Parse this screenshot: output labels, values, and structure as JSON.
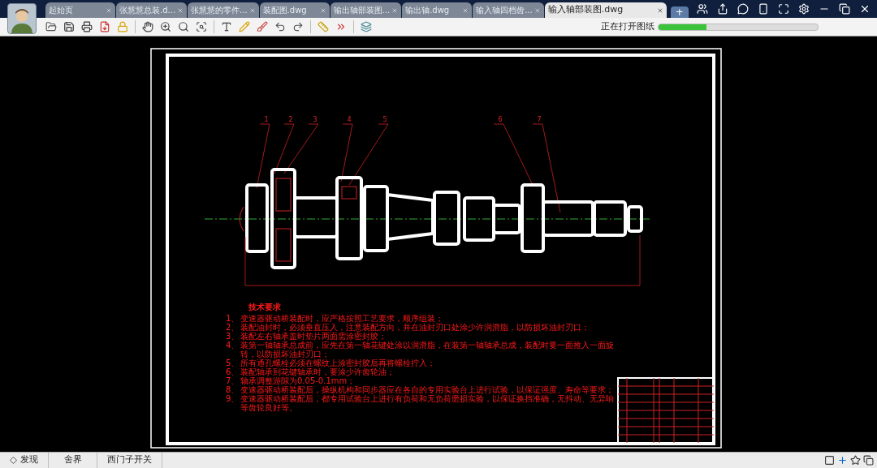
{
  "tabs": [
    {
      "label": "起始页",
      "selected": false
    },
    {
      "label": "张慧慧总装.d...",
      "selected": false
    },
    {
      "label": "张慧慧的零件...",
      "selected": false
    },
    {
      "label": "装配图.dwg",
      "selected": false
    },
    {
      "label": "输出轴部装图...",
      "selected": false
    },
    {
      "label": "输出轴.dwg",
      "selected": false
    },
    {
      "label": "输入轴四档齿...",
      "selected": false
    },
    {
      "label": "输入轴部装图.dwg",
      "selected": true
    }
  ],
  "new_tab": "+",
  "loading": {
    "label": "正在打开图纸",
    "level": 0.3
  },
  "drawing": {
    "balloons": [
      "1",
      "2",
      "3",
      "4",
      "5",
      "6",
      "7"
    ],
    "notes_title": "技术要求",
    "notes": [
      {
        "number": "1、",
        "text": "变速器驱动桥装配时，应严格按照工艺要求，顺序组装；"
      },
      {
        "number": "2、",
        "text": "装配油封时，必须垂直压入，注意装配方向，并在油封刃口处涂少许润滑脂，以防损坏油封刃口；"
      },
      {
        "number": "3、",
        "text": "装配左右轴承盖时垫片两面需涂密封胶；"
      },
      {
        "number": "4、",
        "text": "装第一轴轴承总成前，应先在第一轴花键处涂以润滑脂，在装第一轴轴承总成，装配时要一面推入一面旋转，以防损坏油封刃口；"
      },
      {
        "number": "5、",
        "text": "所有通孔螺栓必须在螺纹上涂密封胶后再将螺栓拧入；"
      },
      {
        "number": "6、",
        "text": "装配轴承到花键轴承时，要涂少许齿轮油；"
      },
      {
        "number": "7、",
        "text": "轴承调整游隙为0.05-0.1mm；"
      },
      {
        "number": "8、",
        "text": "变速器驱动桥装配后，操纵机构和同步器应在各自的专用实验台上进行试验，以保证强度、寿命等要求；"
      },
      {
        "number": "9、",
        "text": "变速器驱动桥装配后，都专用试验台上进行有负荷和无负荷磨损实验，以保证换挡准确，无抖动、无异响等齿轮良好等。"
      }
    ]
  },
  "status_bar": {
    "items": [
      {
        "label": "发现",
        "kind": "diamond"
      },
      {
        "label": "舍界",
        "kind": "plain"
      },
      {
        "label": "西门子开关",
        "kind": "plain"
      }
    ]
  }
}
